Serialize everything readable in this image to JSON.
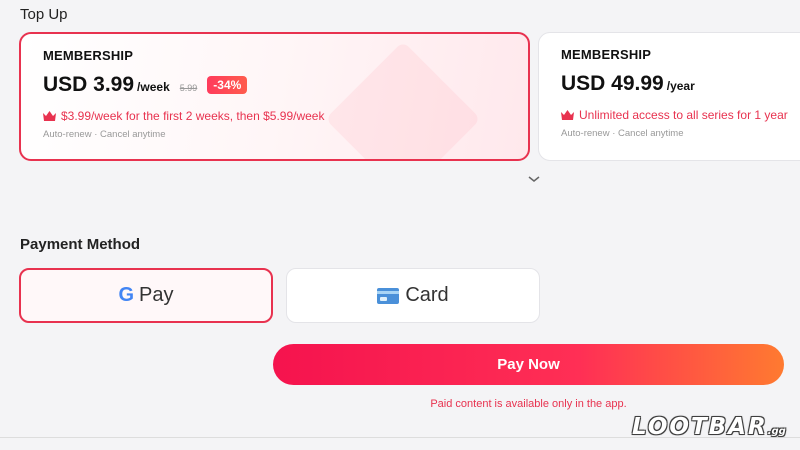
{
  "top_up": {
    "title": "Top Up",
    "plans": [
      {
        "name": "MEMBERSHIP",
        "price": "USD 3.99",
        "period": "/week",
        "old_price": "5.99",
        "discount": "-34%",
        "description": "$3.99/week for the first 2 weeks, then $5.99/week",
        "note": "Auto-renew · Cancel anytime",
        "selected": true
      },
      {
        "name": "MEMBERSHIP",
        "price": "USD 49.99",
        "period": "/year",
        "description": "Unlimited access to all series for 1 year",
        "note": "Auto-renew · Cancel anytime",
        "selected": false
      }
    ]
  },
  "payment": {
    "title": "Payment Method",
    "options": [
      {
        "label": "Pay",
        "icon": "google-g-icon",
        "selected": true
      },
      {
        "label": "Card",
        "icon": "card-icon",
        "selected": false
      }
    ],
    "pay_button": "Pay Now",
    "note": "Paid content is available only in the app."
  },
  "watermark": {
    "text": "LOOTBAR",
    "suffix": ".gg"
  },
  "colors": {
    "accent": "#e8324f",
    "button_start": "#f5134e",
    "button_end": "#ff7a30",
    "background": "#f4f4f6"
  }
}
